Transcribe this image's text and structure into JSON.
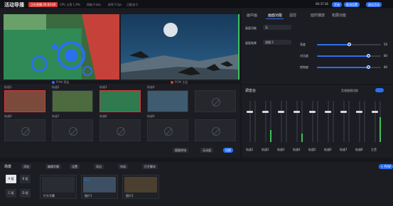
{
  "app": {
    "title": "活动导播",
    "live_badge": "正在直播 00:00:00",
    "stats": [
      "CPU 占用 1.9%",
      "网络 0 kbs",
      "帧率 0 fps",
      "已推流 0"
    ],
    "clock": "00:37:36",
    "buttons": [
      "开始",
      "推流设置",
      "退出活动"
    ]
  },
  "preview": {
    "pvw_label": "PVW 预监",
    "pgm_label": "PGM 主监"
  },
  "sources": [
    {
      "label": "轨道1"
    },
    {
      "label": "轨道2"
    },
    {
      "label": "轨道3"
    },
    {
      "label": "轨道4"
    },
    {
      "label": ""
    },
    {
      "label": "轨道6"
    },
    {
      "label": "轨道7"
    },
    {
      "label": "轨道8"
    },
    {
      "label": "轨道9"
    },
    {
      "label": ""
    }
  ],
  "switch_row": {
    "transition": "随意转场",
    "mode": "无动画",
    "apply": "切换"
  },
  "side_tabs": [
    "画中画",
    "画面功能",
    "遥控",
    "延时播放",
    "拓展功能"
  ],
  "image_settings": {
    "label1": "画面功能",
    "value1": "无",
    "label2": "画面效果",
    "value2": "滤镜 2",
    "sliders": [
      {
        "label": "亮度",
        "value": 50,
        "percent": 0.5
      },
      {
        "label": "对比度",
        "value": 80,
        "percent": 0.8
      },
      {
        "label": "饱和度",
        "value": 80,
        "percent": 0.8
      }
    ]
  },
  "mixer": {
    "title": "调音台",
    "toggle": "音频跟随切换",
    "channels": [
      {
        "name": "轨道1",
        "level": 0.0
      },
      {
        "name": "轨道2",
        "level": 0.3
      },
      {
        "name": "轨道3",
        "level": 0.0
      },
      {
        "name": "轨道4",
        "level": 0.2
      },
      {
        "name": "轨道5",
        "level": 0.0
      },
      {
        "name": "轨道6",
        "level": 0.0
      },
      {
        "name": "轨道7",
        "level": 0.0
      },
      {
        "name": "轨道8",
        "level": 0.0
      },
      {
        "name": "主音",
        "level": 0.6
      }
    ]
  },
  "scenes": {
    "title": "场景",
    "actions": [
      "添加",
      "编辑字幕",
      "设置",
      "导出",
      "布局",
      "打开脚本"
    ],
    "scene_buttons": [
      "A 组",
      "B 组",
      "C 组",
      "D 组"
    ],
    "cards": [
      {
        "name": "片头字幕",
        "tag": ""
      },
      {
        "name": "图片1",
        "tag": "MV"
      },
      {
        "name": "图片2",
        "tag": ""
      }
    ],
    "add": "+ PVW"
  },
  "colors": {
    "accent": "#2b6ff2",
    "live": "#d83a3a",
    "pgm": "#3fbf5c",
    "pvw": "#d83a3a"
  }
}
